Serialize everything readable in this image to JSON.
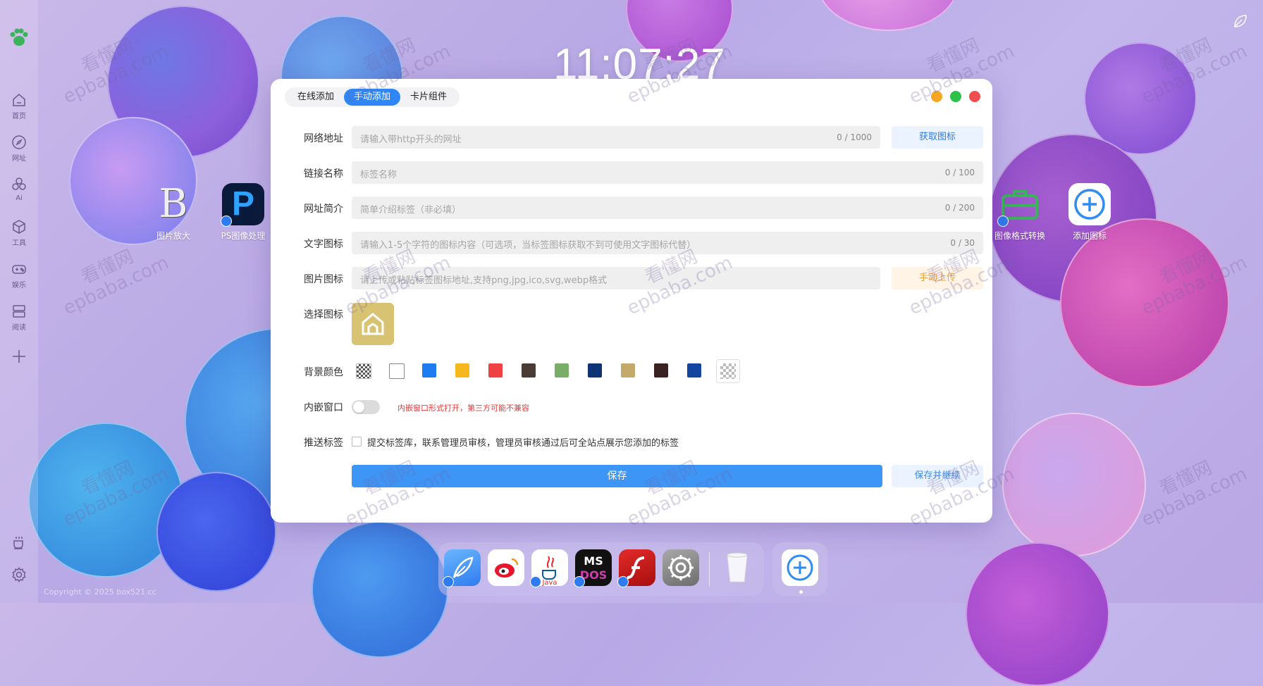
{
  "clock": "11:07:27",
  "sidebar": {
    "items": [
      {
        "label": "首页",
        "icon": "home-icon"
      },
      {
        "label": "网址",
        "icon": "compass-icon"
      },
      {
        "label": "Ai",
        "icon": "ai-icon"
      },
      {
        "label": "工具",
        "icon": "cube-icon"
      },
      {
        "label": "娱乐",
        "icon": "gamepad-icon"
      },
      {
        "label": "阅读",
        "icon": "book-icon"
      }
    ]
  },
  "desktop_apps": {
    "left": [
      {
        "label": "图片放大",
        "icon": "B"
      },
      {
        "label": "PS图像处理",
        "icon": "P"
      }
    ],
    "right": [
      {
        "label": "图像格式转换",
        "icon": "briefcase-icon"
      },
      {
        "label": "添加图标",
        "icon": "plus-circle-icon"
      }
    ]
  },
  "modal": {
    "tabs": [
      {
        "label": "在线添加",
        "active": false
      },
      {
        "label": "手动添加",
        "active": true
      },
      {
        "label": "卡片组件",
        "active": false
      }
    ],
    "window_buttons": {
      "minimize_color": "#f5a623",
      "maximize_color": "#2cc14a",
      "close_color": "#f04e4e"
    },
    "fields": {
      "url": {
        "label": "网络地址",
        "placeholder": "请输入带http开头的网址",
        "count": "0 / 1000",
        "button": "获取图标"
      },
      "name": {
        "label": "链接名称",
        "placeholder": "标签名称",
        "count": "0 / 100"
      },
      "desc": {
        "label": "网址简介",
        "placeholder": "简单介绍标签（非必填）",
        "count": "0 / 200"
      },
      "text_icon": {
        "label": "文字图标",
        "placeholder": "请输入1-5个字符的图标内容（可选项，当标签图标获取不到可使用文字图标代替）",
        "count": "0 / 30"
      },
      "image_icon": {
        "label": "图片图标",
        "placeholder": "请上传或粘贴标签图标地址,支持png,jpg,ico,svg,webp格式",
        "button": "手动上传"
      },
      "choose_icon": {
        "label": "选择图标"
      },
      "bg_color": {
        "label": "背景颜色",
        "swatches": [
          "transparent",
          "#ffffff",
          "#1e7bf0",
          "#f6b81e",
          "#ef4242",
          "#4a3c34",
          "#7aad68",
          "#0f3476",
          "#c3a96a",
          "#3a2222",
          "#1446a0",
          "pattern"
        ]
      },
      "embed": {
        "label": "内嵌窗口",
        "hint": "内嵌窗口形式打开，第三方可能不兼容"
      },
      "push": {
        "label": "推送标签",
        "text": "提交标签库，联系管理员审核，管理员审核通过后可全站点展示您添加的标签"
      }
    },
    "save": "保存",
    "save_continue": "保存并继续"
  },
  "watermark": {
    "cn": "看懂网",
    "en": "epbaba.com"
  },
  "dock": {
    "apps": [
      "feather-app-icon",
      "weibo-app-icon",
      "java-app-icon",
      "msdos-app-icon",
      "flash-app-icon",
      "settings-app-icon",
      "trash-icon"
    ],
    "add": "plus-circle-icon"
  },
  "copyright": "Copyright © 2025 box521.cc"
}
